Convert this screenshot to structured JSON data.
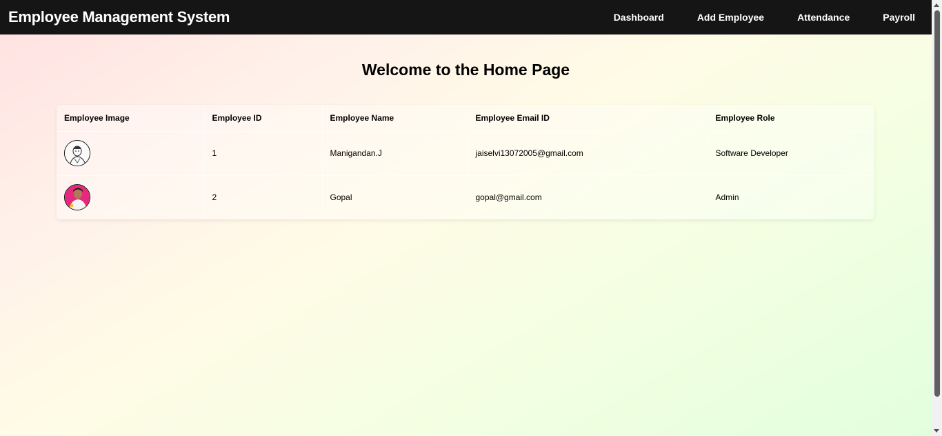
{
  "navbar": {
    "brand": "Employee Management System",
    "links": [
      "Dashboard",
      "Add Employee",
      "Attendance",
      "Payroll"
    ]
  },
  "main": {
    "title": "Welcome to the Home Page"
  },
  "table": {
    "columns": [
      "Employee Image",
      "Employee ID",
      "Employee Name",
      "Employee Email ID",
      "Employee Role"
    ],
    "rows": [
      {
        "image": "sketch-portrait",
        "id": "1",
        "name": "Manigandan.J",
        "email": "jaiselvi13072005@gmail.com",
        "role": "Software Developer"
      },
      {
        "image": "photo-portrait-pink",
        "id": "2",
        "name": "Gopal",
        "email": "gopal@gmail.com",
        "role": "Admin"
      }
    ]
  },
  "colors": {
    "navbar_bg": "#151515",
    "navbar_text": "#ffffff",
    "scroll_thumb": "#5f5f5f"
  }
}
